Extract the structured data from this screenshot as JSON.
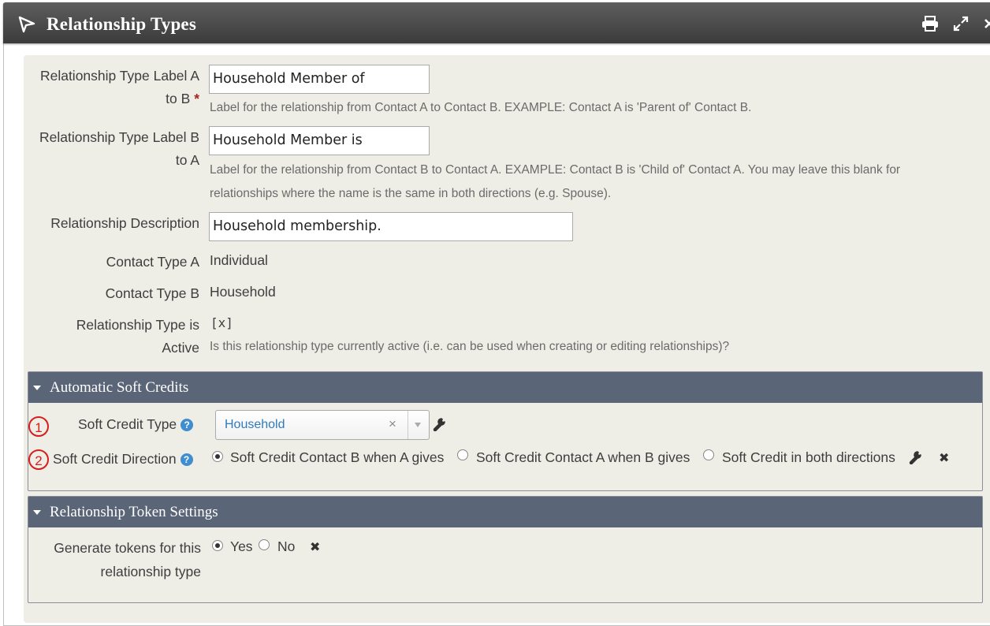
{
  "dialog": {
    "title": "Relationship Types",
    "actions": [
      "print-icon",
      "fullscreen-icon",
      "close-icon"
    ]
  },
  "form": {
    "label_a_b": {
      "label_line1": "Relationship Type Label A",
      "label_line2": "to B",
      "required_mark": "*",
      "value": "Household Member of",
      "help": "Label for the relationship from Contact A to Contact B. EXAMPLE: Contact A is 'Parent of' Contact B."
    },
    "label_b_a": {
      "label_line1": "Relationship Type Label B",
      "label_line2": "to A",
      "value": "Household Member is",
      "help_line1": "Label for the relationship from Contact B to Contact A. EXAMPLE: Contact B is 'Child of' Contact A. You may leave this blank for",
      "help_line2": "relationships where the name is the same in both directions (e.g. Spouse)."
    },
    "description": {
      "label": "Relationship Description",
      "value": "Household membership."
    },
    "contact_type_a": {
      "label": "Contact Type A",
      "value": "Individual"
    },
    "contact_type_b": {
      "label": "Contact Type B",
      "value": "Household"
    },
    "active": {
      "label_line1": "Relationship Type is",
      "label_line2": "Active",
      "value": "[x]",
      "help": "Is this relationship type currently active (i.e. can be used when creating or editing relationships)?"
    }
  },
  "soft_credits": {
    "heading": "Automatic Soft Credits",
    "type": {
      "badge": "1",
      "label": "Soft Credit Type",
      "selected": "Household",
      "clear": "×"
    },
    "direction": {
      "badge": "2",
      "label": "Soft Credit Direction",
      "options": [
        "Soft Credit Contact B when A gives",
        "Soft Credit Contact A when B gives",
        "Soft Credit in both directions"
      ],
      "selected_index": 0,
      "clear": "✖"
    }
  },
  "tokens": {
    "heading": "Relationship Token Settings",
    "label_line1": "Generate tokens for this",
    "label_line2": "relationship type",
    "options": [
      "Yes",
      "No"
    ],
    "selected_index": 0,
    "clear": "✖"
  },
  "colors": {
    "section_header": "#5b6578",
    "form_bg": "#eeede6",
    "badge": "#d81d1d",
    "link": "#2f7bbd"
  }
}
